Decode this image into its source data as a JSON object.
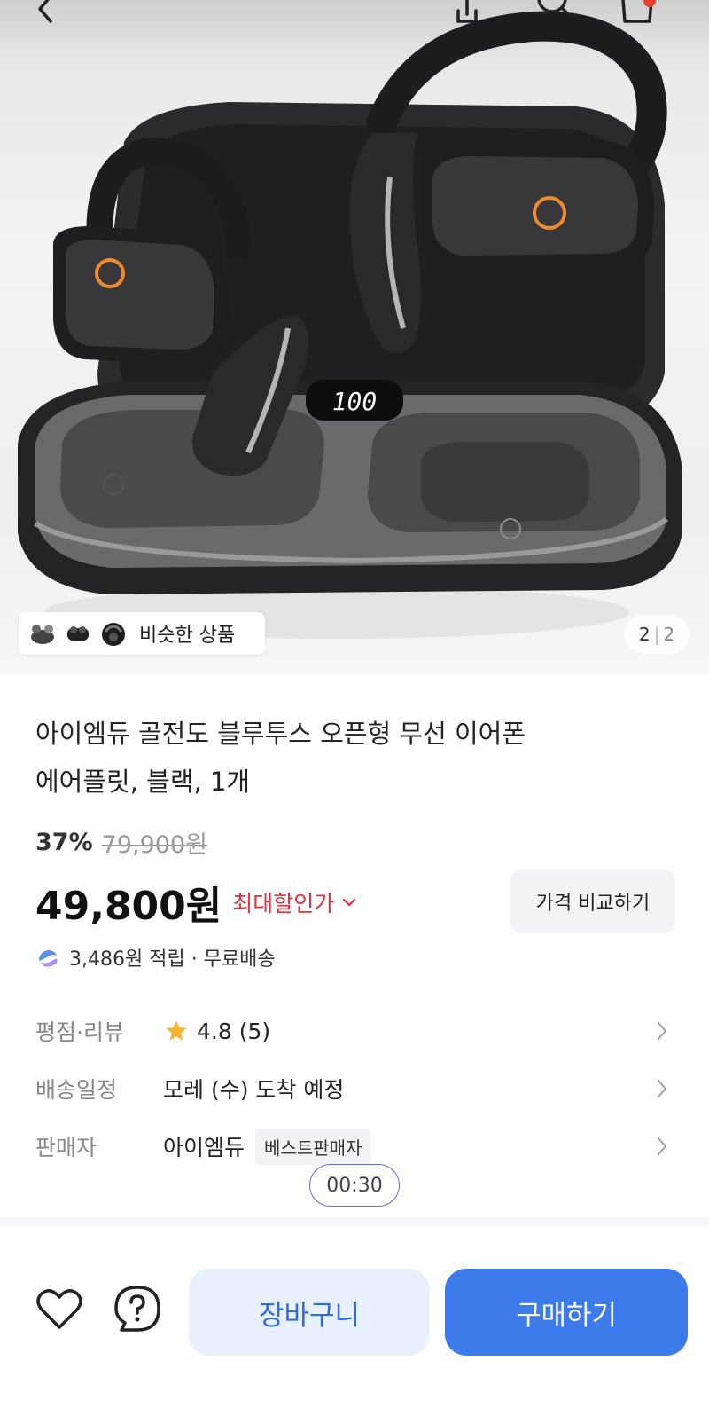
{
  "gallery": {
    "similar_label": "비슷한 상품",
    "page_current": "2",
    "page_separator": "|",
    "page_total": "2",
    "case_display": "100"
  },
  "product": {
    "title_line1": "아이엠듀 골전도 블루투스 오픈형 무선 이어폰",
    "title_line2": "에어플릿, 블랙, 1개",
    "discount_percent": "37%",
    "original_price": "79,900원",
    "price": "49,800원",
    "max_discount_label": "최대할인가",
    "compare_button": "가격 비교하기",
    "reward_text": "3,486원 적립 · 무료배송"
  },
  "info": {
    "rating_label": "평점·리뷰",
    "rating_value": "4.8 (5)",
    "delivery_label": "배송일정",
    "delivery_value": "모레 (수) 도착 예정",
    "seller_label": "판매자",
    "seller_value": "아이엠듀",
    "seller_badge": "베스트판매자"
  },
  "timer": "00:30",
  "bottom": {
    "cart_button": "장바구니",
    "buy_button": "구매하기"
  },
  "colors": {
    "accent_blue": "#3d7bea",
    "cart_bg": "#e8f0fd",
    "discount_red": "#e5303d",
    "star": "#f6b52c"
  }
}
